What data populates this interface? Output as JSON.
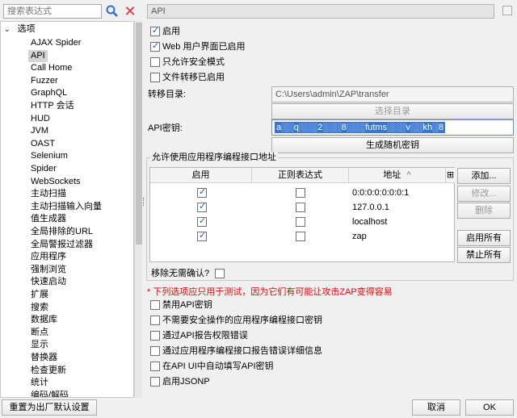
{
  "left": {
    "search_placeholder": "搜索表达式",
    "root_label": "选项",
    "items": [
      {
        "label": "AJAX Spider"
      },
      {
        "label": "API"
      },
      {
        "label": "Call Home"
      },
      {
        "label": "Fuzzer"
      },
      {
        "label": "GraphQL"
      },
      {
        "label": "HTTP 会话"
      },
      {
        "label": "HUD"
      },
      {
        "label": "JVM"
      },
      {
        "label": "OAST"
      },
      {
        "label": "Selenium"
      },
      {
        "label": "Spider"
      },
      {
        "label": "WebSockets"
      },
      {
        "label": "主动扫描"
      },
      {
        "label": "主动扫描输入向量"
      },
      {
        "label": "值生成器"
      },
      {
        "label": "全局排除的URL"
      },
      {
        "label": "全局警报过滤器"
      },
      {
        "label": "应用程序"
      },
      {
        "label": "强制浏览"
      },
      {
        "label": "快速启动"
      },
      {
        "label": "扩展"
      },
      {
        "label": "搜索"
      },
      {
        "label": "数据库"
      },
      {
        "label": "断点"
      },
      {
        "label": "显示"
      },
      {
        "label": "替换器"
      },
      {
        "label": "检查更新"
      },
      {
        "label": "统计"
      },
      {
        "label": "编码/解码"
      }
    ],
    "selected_index": 1
  },
  "panel": {
    "title": "API",
    "enabled_label": "启用",
    "web_ui_label": "Web 用户界面已启用",
    "secure_only_label": "只允许安全模式",
    "file_transfer_label": "文件转移已启用",
    "transfer_dir_label": "转移目录:",
    "transfer_dir_value": "C:\\Users\\admin\\ZAP\\transfer",
    "select_dir_button": "选择目录",
    "api_key_label": "API密钥:",
    "api_key_value": "a░░q░░░2░░░8░░░futms░░░v░░kh░8",
    "generate_key_button": "生成随机密钥",
    "group_title": "允许使用应用程序编程接口地址",
    "table": {
      "columns": [
        "启用",
        "正则表达式",
        "地址"
      ],
      "sort_indicator": "^",
      "rows": [
        {
          "enabled": true,
          "regex": false,
          "address": "0:0:0:0:0:0:0:1"
        },
        {
          "enabled": true,
          "regex": false,
          "address": "127.0.0.1"
        },
        {
          "enabled": true,
          "regex": false,
          "address": "localhost"
        },
        {
          "enabled": true,
          "regex": false,
          "address": "zap"
        }
      ]
    },
    "buttons": {
      "add": "添加...",
      "modify": "修改...",
      "delete": "删除",
      "enable_all": "启用所有",
      "disable_all": "禁止所有"
    },
    "remove_no_confirm_label": "移除无需确认?",
    "warning_note": "* 下列选项应只用于测试，因为它们有可能让攻击ZAP变得容易",
    "test_options": [
      {
        "label": "禁用API密钥",
        "checked": false
      },
      {
        "label": "不需要安全操作的应用程序编程接口密钥",
        "checked": false
      },
      {
        "label": "通过API报告权限错误",
        "checked": false
      },
      {
        "label": "通过应用程序编程接口报告错误详细信息",
        "checked": false
      },
      {
        "label": "在API UI中自动填写API密钥",
        "checked": false
      },
      {
        "label": "启用JSONP",
        "checked": false
      }
    ],
    "checks": {
      "enabled": true,
      "web_ui": true,
      "secure_only": false,
      "file_transfer": false,
      "remove_no_confirm": false
    }
  },
  "footer": {
    "reset_button": "重置为出厂默认设置",
    "cancel_button": "取消",
    "ok_button": "OK"
  },
  "colors": {
    "selection": "#3875d7",
    "warning": "#e00000",
    "check": "#1a56c5"
  }
}
